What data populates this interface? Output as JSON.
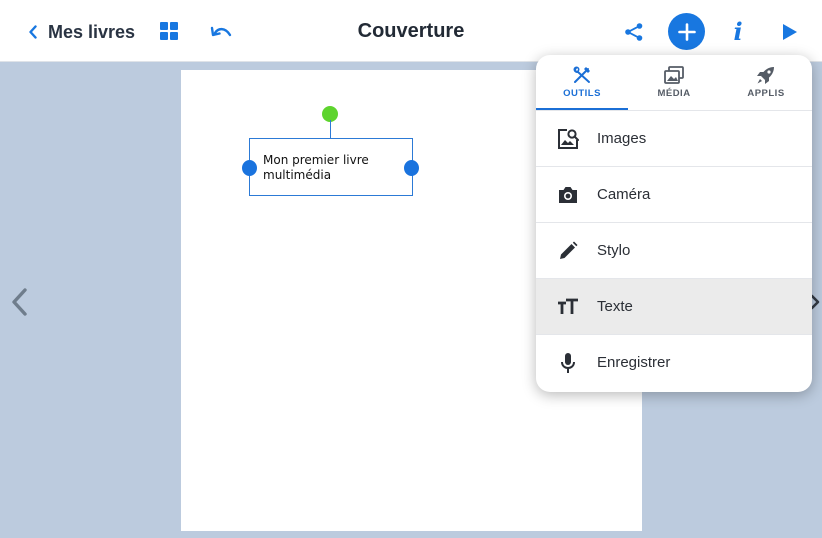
{
  "topbar": {
    "back_label": "Mes livres",
    "title": "Couverture"
  },
  "page": {
    "textbox_text": "Mon premier livre multimédia"
  },
  "menu": {
    "tabs": [
      {
        "label": "OUTILS",
        "icon": "tools-icon",
        "active": true
      },
      {
        "label": "MÉDIA",
        "icon": "media-icon",
        "active": false
      },
      {
        "label": "APPLIS",
        "icon": "rocket-icon",
        "active": false
      }
    ],
    "items": [
      {
        "label": "Images",
        "icon": "image-search-icon"
      },
      {
        "label": "Caméra",
        "icon": "camera-icon"
      },
      {
        "label": "Stylo",
        "icon": "pen-icon"
      },
      {
        "label": "Texte",
        "icon": "text-icon",
        "highlighted": true
      },
      {
        "label": "Enregistrer",
        "icon": "microphone-icon"
      }
    ]
  },
  "colors": {
    "accent": "#1877e0",
    "background": "#bccbde",
    "rotate_handle": "#5ed42e",
    "highlight": "#ebebeb"
  }
}
